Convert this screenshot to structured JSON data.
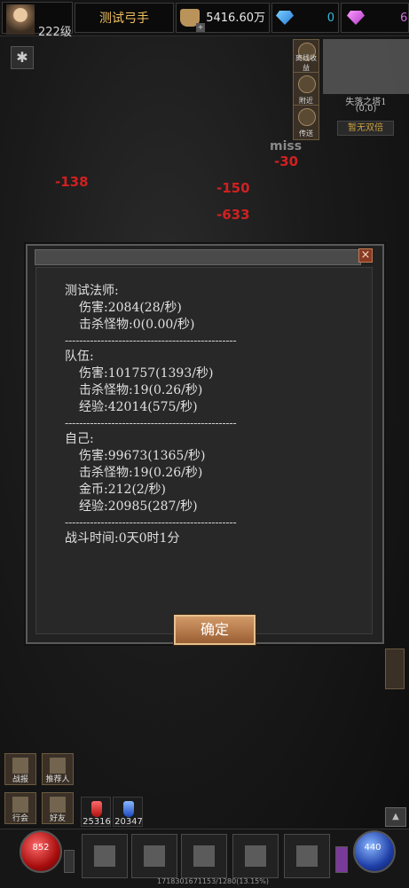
{
  "topbar": {
    "player_name": "测试弓手",
    "level": "222级",
    "gold": "5416.60万",
    "diamonds": "0",
    "gems": "6"
  },
  "side_buttons": [
    "离线收益",
    "附近",
    "传送"
  ],
  "map": {
    "name": "失落之塔1",
    "coords": "(0,0)",
    "double_btn": "暂无双倍"
  },
  "floating": {
    "miss": "miss",
    "dmg1": "-30",
    "dmg2": "-138",
    "dmg3": "-150",
    "dmg4": "-633"
  },
  "dialog": {
    "mage": {
      "header": "测试法师:",
      "damage": "伤害:2084(28/秒)",
      "kills": "击杀怪物:0(0.00/秒)"
    },
    "separator": "------------------------------------------------",
    "team": {
      "header": "队伍:",
      "damage": "伤害:101757(1393/秒)",
      "kills": "击杀怪物:19(0.26/秒)",
      "exp": "经验:42014(575/秒)"
    },
    "self": {
      "header": "自己:",
      "damage": "伤害:99673(1365/秒)",
      "kills": "击杀怪物:19(0.26/秒)",
      "gold": "金币:212(2/秒)",
      "exp": "经验:20985(287/秒)"
    },
    "battle_time": "战斗时间:0天0时1分",
    "ok": "确定"
  },
  "bottom_buttons": {
    "rank": "战报",
    "recommend": "推荐人",
    "guild": "行会",
    "friends": "好友"
  },
  "potions": {
    "red_count": "25316",
    "blue_count": "20347"
  },
  "orbs": {
    "hp": "852",
    "mp": "440"
  },
  "exp_text": "1718301671153/1280(13.15%)"
}
